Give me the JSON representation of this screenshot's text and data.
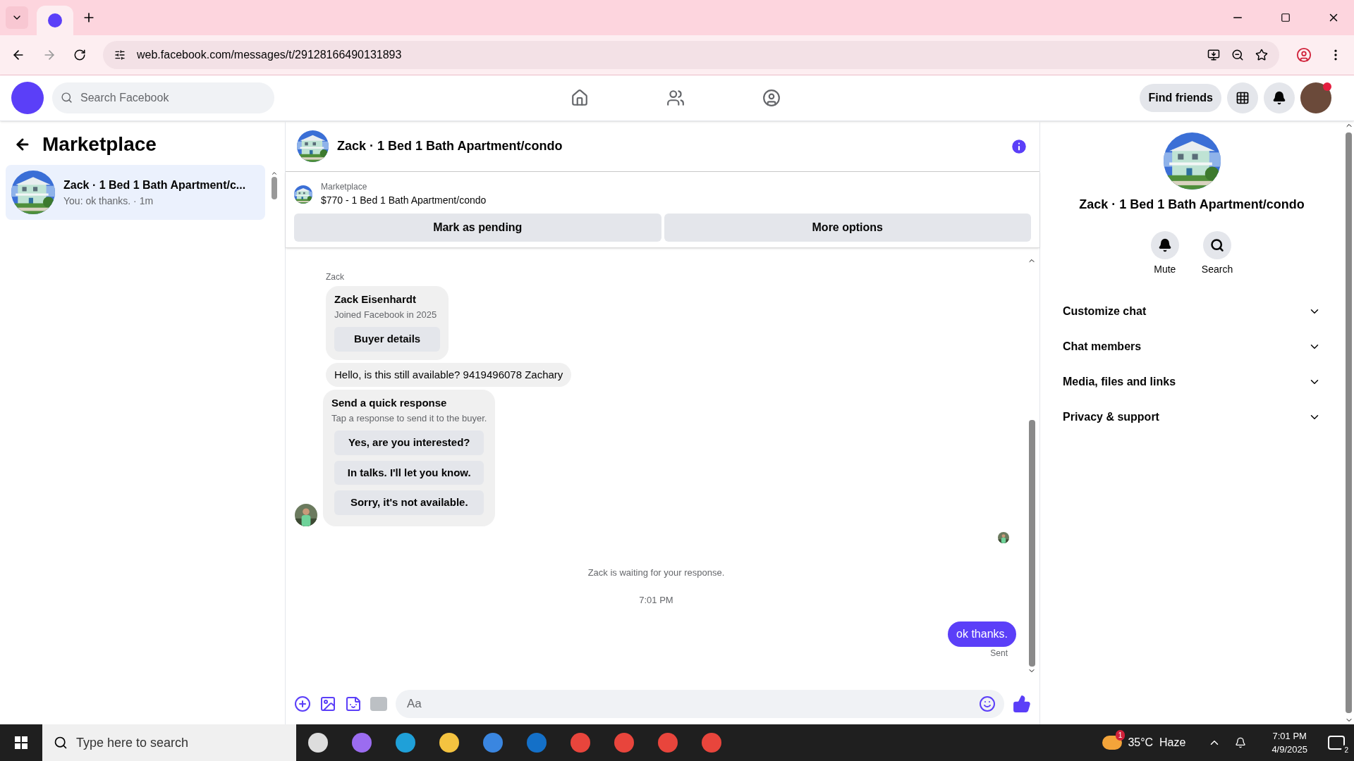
{
  "browser": {
    "url": "web.facebook.com/messages/t/29128166490131893"
  },
  "header": {
    "search_placeholder": "Search Facebook",
    "find_friends": "Find friends",
    "notification_dot": true
  },
  "sidebar": {
    "title": "Marketplace",
    "conversations": [
      {
        "title": "Zack · 1 Bed 1 Bath Apartment/c...",
        "preview": "You: ok thanks. · 1m",
        "selected": true
      }
    ]
  },
  "chat": {
    "title": "Zack · 1 Bed 1 Bath Apartment/condo",
    "listing": {
      "label": "Marketplace",
      "title": "$770 - 1 Bed 1 Bath Apartment/condo"
    },
    "actions": [
      "Mark as pending",
      "More options"
    ],
    "messages": [
      {
        "kind": "sender",
        "text": "Zack"
      },
      {
        "kind": "profile_card",
        "name": "Zack Eisenhardt",
        "subtitle": "Joined Facebook in 2025",
        "button": "Buyer details"
      },
      {
        "kind": "incoming",
        "text": "Hello, is this still available? 9419496078 Zachary"
      },
      {
        "kind": "quick_response",
        "title": "Send a quick response",
        "subtitle": "Tap a response to send it to the buyer.",
        "options": [
          "Yes, are you interested?",
          "In talks. I'll let you know.",
          "Sorry, it's not available."
        ]
      },
      {
        "kind": "status",
        "text": "Zack is waiting for your response."
      },
      {
        "kind": "timestamp",
        "text": "7:01 PM"
      },
      {
        "kind": "outgoing",
        "text": "ok thanks.",
        "status": "Sent"
      }
    ],
    "composer_placeholder": "Aa"
  },
  "details": {
    "title": "Zack · 1 Bed 1 Bath Apartment/condo",
    "actions": [
      {
        "kind": "mute",
        "label": "Mute"
      },
      {
        "kind": "search",
        "label": "Search"
      }
    ],
    "sections": [
      {
        "label": "Customize chat",
        "expanded": false
      },
      {
        "label": "Chat members",
        "expanded": false
      },
      {
        "label": "Media, files and links",
        "expanded": false
      },
      {
        "label": "Privacy & support",
        "expanded": false
      }
    ]
  },
  "taskbar": {
    "search_placeholder": "Type here to search",
    "weather_badge": "1",
    "weather": "35°C  Haze",
    "time": "7:01 PM",
    "date": "4/9/2025",
    "notification_count": "2"
  }
}
